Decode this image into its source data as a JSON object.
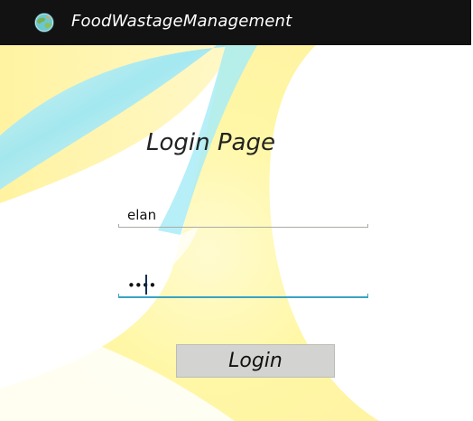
{
  "app": {
    "title": "FoodWastageManagement",
    "icon": "globe-icon",
    "action_bar_color": "#121212"
  },
  "page": {
    "heading": "Login Page"
  },
  "form": {
    "username_value": "elan",
    "password_value": "••••",
    "login_label": "Login"
  },
  "colors": {
    "focus_accent": "#3aa2c4",
    "button_bg": "#d3d3d1",
    "background_yellow": "#fff8a8",
    "background_cyan": "#9ee8f6"
  }
}
